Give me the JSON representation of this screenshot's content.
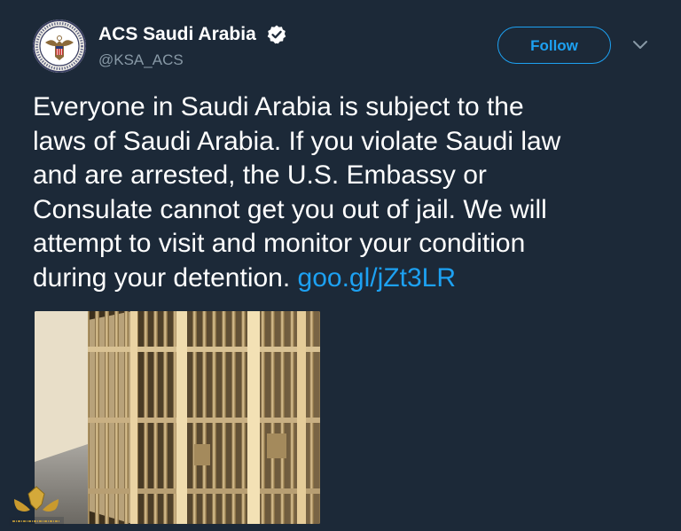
{
  "tweet": {
    "author": {
      "name": "ACS Saudi Arabia",
      "handle": "@KSA_ACS",
      "verified": true,
      "avatar_icon": "us-embassy-seal-icon"
    },
    "follow_label": "Follow",
    "menu_icon": "chevron-down-icon",
    "text_lines": [
      "Everyone in Saudi Arabia is subject to the",
      "laws of Saudi Arabia. If you violate Saudi law",
      "and are arrested, the U.S. Embassy or",
      "Consulate cannot get you out of jail. We will",
      "attempt to visit and monitor your condition",
      "during your detention."
    ],
    "link": "goo.gl/jZt3LR",
    "media": {
      "icon": "jail-cells-photo"
    },
    "watermark": {
      "text": "المنتدى المصري للمعادن والمعادن"
    }
  },
  "colors": {
    "background": "#1c2938",
    "text": "#ffffff",
    "secondary_text": "#8899a6",
    "accent": "#1da1f2"
  }
}
